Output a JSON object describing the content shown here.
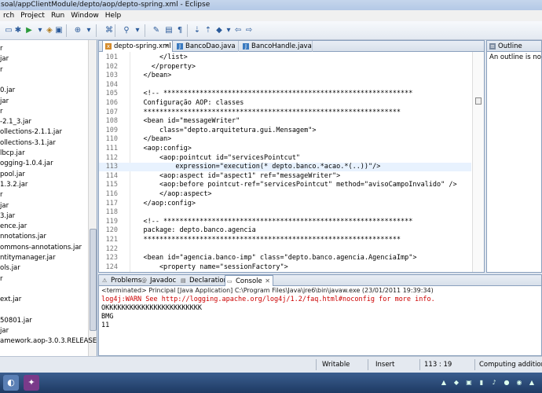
{
  "window": {
    "title": "soal/appClientModule/depto/aop/depto-spring.xml - Eclipse"
  },
  "menu": [
    "rch",
    "Project",
    "Run",
    "Window",
    "Help"
  ],
  "left_panel": {
    "items": [
      "r",
      "jar",
      "r",
      "",
      "0.jar",
      "jar",
      "r",
      "-2.1_3.jar",
      "ollections-2.1.1.jar",
      "ollections-3.1.jar",
      "lbcp.jar",
      "ogging-1.0.4.jar",
      "pool.jar",
      "1.3.2.jar",
      "r",
      "jar",
      "3.jar",
      "ence.jar",
      "nnotations.jar",
      "ommons-annotations.jar",
      "ntitymanager.jar",
      "ols.jar",
      "r",
      "",
      "ext.jar",
      "",
      "50801.jar",
      "jar",
      "amework.aop-3.0.3.RELEASE.jar"
    ]
  },
  "editor": {
    "tabs": [
      {
        "label": "depto-spring.xml",
        "active": true
      },
      {
        "label": "BancoDao.java",
        "active": false
      },
      {
        "label": "BancoHandle.java",
        "active": false
      }
    ],
    "lines": [
      {
        "num": "101",
        "text": "        </list>"
      },
      {
        "num": "102",
        "text": "      </property>"
      },
      {
        "num": "103",
        "text": "    </bean>"
      },
      {
        "num": "104",
        "text": ""
      },
      {
        "num": "105",
        "text": "    <!-- **************************************************************"
      },
      {
        "num": "106",
        "text": "    Configuração AOP: classes"
      },
      {
        "num": "107",
        "text": "    ****************************************************************"
      },
      {
        "num": "108",
        "text": "    <bean id=\"messageWriter\""
      },
      {
        "num": "109",
        "text": "        class=\"depto.arquitetura.gui.Mensagem\">"
      },
      {
        "num": "110",
        "text": "    </bean>"
      },
      {
        "num": "111",
        "text": "    <aop:config>"
      },
      {
        "num": "112",
        "text": "        <aop:pointcut id=\"servicesPointcut\""
      },
      {
        "num": "113",
        "text": "            expression=\"execution(* depto.banco.*acao.*(..))\"/>"
      },
      {
        "num": "114",
        "text": "        <aop:aspect id=\"aspect1\" ref=\"messageWriter\">"
      },
      {
        "num": "115",
        "text": "        <aop:before pointcut-ref=\"servicesPointcut\" method=\"avisoCampoInvalido\" />"
      },
      {
        "num": "116",
        "text": "        </aop:aspect>"
      },
      {
        "num": "117",
        "text": "    </aop:config>"
      },
      {
        "num": "118",
        "text": ""
      },
      {
        "num": "119",
        "text": "    <!-- **************************************************************"
      },
      {
        "num": "120",
        "text": "    package: depto.banco.agencia"
      },
      {
        "num": "121",
        "text": "    ****************************************************************"
      },
      {
        "num": "122",
        "text": ""
      },
      {
        "num": "123",
        "text": "    <bean id=\"agencia.banco-imp\" class=\"depto.banco.agencia.AgenciaImp\">"
      },
      {
        "num": "124",
        "text": "        <property name=\"sessionFactory\">"
      }
    ],
    "current_line": "113"
  },
  "outline": {
    "title": "Outline",
    "message": "An outline is not av"
  },
  "console": {
    "tabs": [
      "Problems",
      "Javadoc",
      "Declaration",
      "Console"
    ],
    "active_tab": "Console",
    "status": "<terminated> Principal [Java Application] C:\\Program Files\\Java\\jre6\\bin\\javaw.exe (23/01/2011 19:39:34)",
    "lines": [
      {
        "text": "log4j:WARN See http://logging.apache.org/log4j/1.2/faq.html#noconfig for more info.",
        "red": true
      },
      {
        "text": "OKKKKKKKKKKKKKKKKKKKKKKKK",
        "red": false
      },
      {
        "text": "BMG",
        "red": false
      },
      {
        "text": "11",
        "red": false
      }
    ]
  },
  "statusbar": {
    "mode": "Writable",
    "insert": "Insert",
    "position": "113 : 19",
    "message": "Computing additional in"
  },
  "colors": {
    "accent": "#2a5a9a",
    "console_error": "#c00000"
  }
}
